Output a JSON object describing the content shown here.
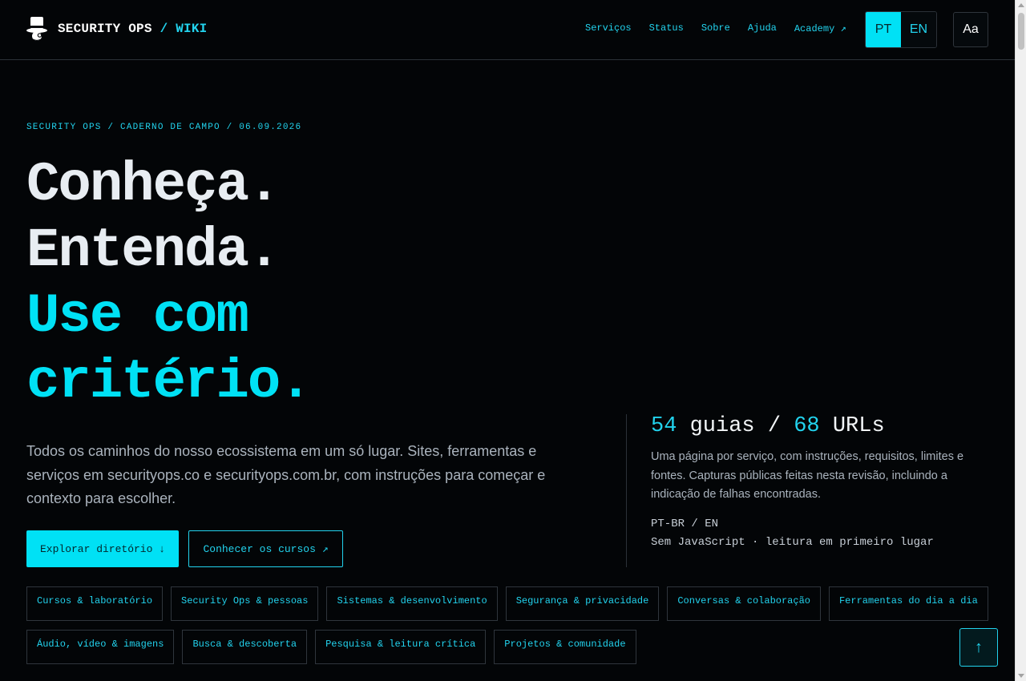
{
  "header": {
    "brand": {
      "name": "SECURITY OPS",
      "separator": "/",
      "section": "WIKI"
    },
    "nav": [
      {
        "label": "Serviços"
      },
      {
        "label": "Status"
      },
      {
        "label": "Sobre"
      },
      {
        "label": "Ajuda"
      },
      {
        "label": "Academy ↗"
      }
    ],
    "language": {
      "options": [
        "PT",
        "EN"
      ],
      "selected": "PT"
    },
    "font_toggle_label": "Aa"
  },
  "hero": {
    "eyebrow": "SECURITY OPS / CADERNO DE CAMPO / 06.09.2026",
    "headline": {
      "line1": "Conheça.",
      "line2": "Entenda.",
      "line3": "Use com",
      "line4": "critério."
    },
    "lead": "Todos os caminhos do nosso ecossistema em um só lugar. Sites, ferramentas e serviços em securityops.co e securityops.com.br, com instruções para começar e contexto para escolher.",
    "primary_button": "Explorar diretório ↓",
    "secondary_button": "Conhecer os cursos ↗"
  },
  "stats": {
    "guides_count": "54",
    "guides_label": "guias",
    "separator": "/",
    "urls_count": "68",
    "urls_label": "URLs",
    "description": "Uma página por serviço, com instruções, requisitos, limites e fontes. Capturas públicas feitas nesta revisão, incluindo a indicação de falhas encontradas.",
    "languages": "PT-BR / EN",
    "note": "Sem JavaScript · leitura em primeiro lugar"
  },
  "categories": [
    "Cursos & laboratório",
    "Security Ops & pessoas",
    "Sistemas & desenvolvimento",
    "Segurança & privacidade",
    "Conversas & colaboração",
    "Ferramentas do dia a dia",
    "Áudio, vídeo & imagens",
    "Busca & descoberta",
    "Pesquisa & leitura crítica",
    "Projetos & comunidade"
  ],
  "back_to_top_label": "↑",
  "colors": {
    "background": "#030507",
    "accent": "#00e1f5",
    "text": "#e6edf3",
    "muted": "#aab3bd",
    "border": "#2b3138"
  }
}
